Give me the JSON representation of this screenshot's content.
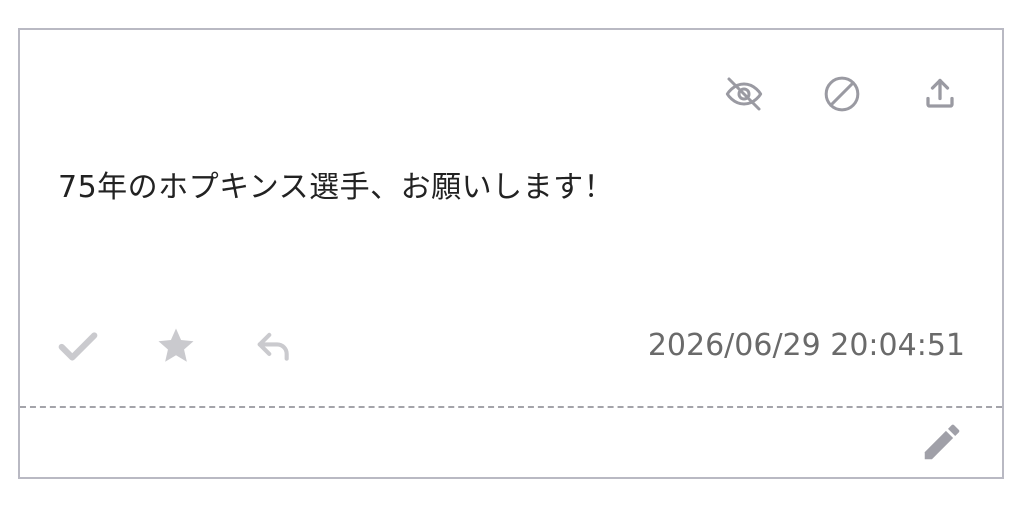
{
  "message": {
    "text": "75年のホプキンス選手、お願いします！",
    "timestamp": "2026/06/29 20:04:51"
  },
  "icons": {
    "hide": "eye-off-icon",
    "block": "ban-icon",
    "share": "upload-icon",
    "check": "check-icon",
    "favorite": "star-icon",
    "reply": "reply-icon",
    "edit": "pencil-icon"
  },
  "colors": {
    "top_icon": "#9a9aa2",
    "bottom_icon": "#cacace",
    "edit_icon": "#a0a0a8",
    "text": "#222222",
    "timestamp": "#6a6a6a",
    "border": "#b9b9c3"
  }
}
